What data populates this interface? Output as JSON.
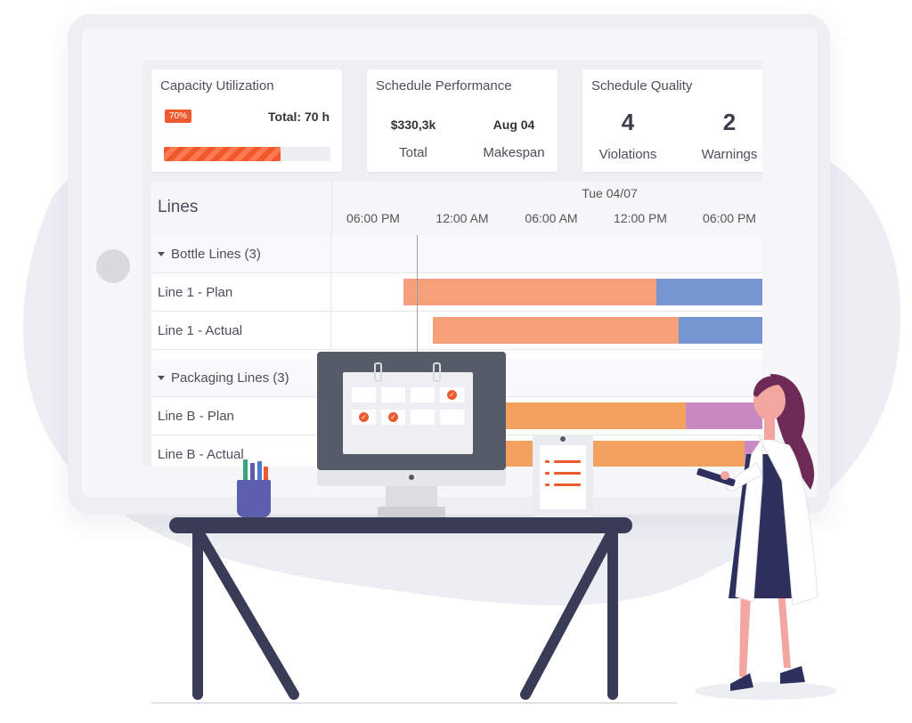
{
  "colors": {
    "accent": "#ee5a2f",
    "bar_salmon": "#f5a07a",
    "bar_blue": "#7596d0",
    "bar_orange": "#f2a25e",
    "bar_purple": "#c98ac4",
    "desk": "#3a3b57",
    "blob": "#ededf4"
  },
  "kpi": {
    "capacity": {
      "title": "Capacity Utilization",
      "badge": "70%",
      "total": "Total: 70 h",
      "progress_percent": 70
    },
    "performance": {
      "title": "Schedule Performance",
      "total_value": "$330,3k",
      "total_label": "Total",
      "makespan_value": "Aug 04",
      "makespan_label": "Makespan"
    },
    "quality": {
      "title": "Schedule Quality",
      "violations_value": "4",
      "violations_label": "Violations",
      "warnings_value": "2",
      "warnings_label": "Warnings"
    }
  },
  "gantt": {
    "side_title": "Lines",
    "date_label": "Tue 04/07",
    "ticks": [
      "06:00 PM",
      "12:00 AM",
      "06:00 AM",
      "12:00 PM",
      "06:00 PM"
    ],
    "rows": [
      {
        "label": "Bottle Lines (3)",
        "group": true
      },
      {
        "label": "Line 1 - Plan",
        "group": false
      },
      {
        "label": "Line 1 - Actual",
        "group": false
      },
      {
        "label": "Packaging Lines (3)",
        "group": true
      },
      {
        "label": "Line B - Plan",
        "group": false
      },
      {
        "label": "Line B - Actual",
        "group": false
      }
    ]
  },
  "icons": {
    "calendar": "calendar-icon",
    "checklist": "checklist-icon",
    "check": "check-icon"
  }
}
